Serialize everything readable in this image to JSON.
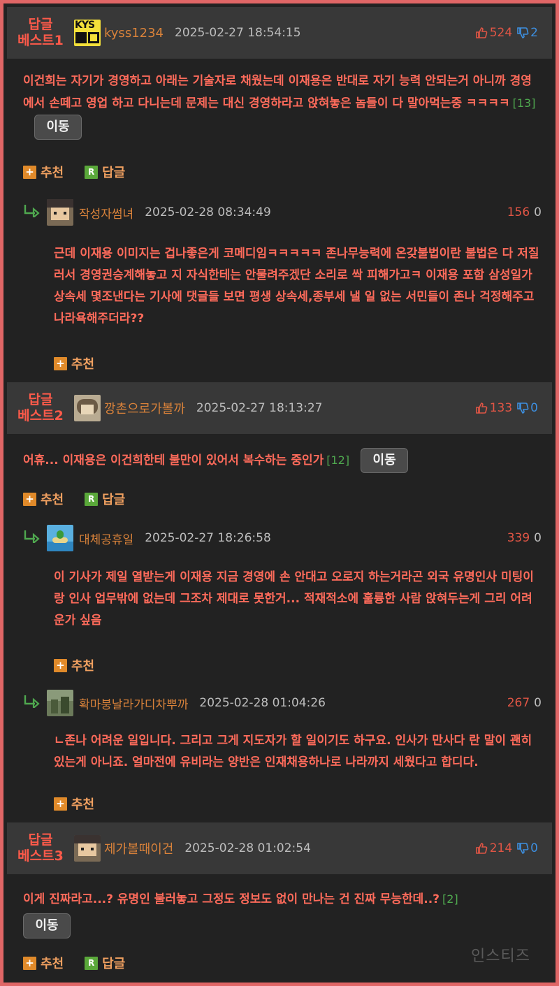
{
  "icons": {
    "thumb_up": "thumb-up-icon",
    "thumb_down": "thumb-down-icon",
    "reply_arrow": "reply-arrow-icon",
    "plus": "plus-icon",
    "reply_r": "reply-r-icon"
  },
  "colors": {
    "accent_red": "#ff6b5b",
    "username": "#d9823a",
    "count_green": "#4fa84f",
    "down_blue": "#3d8fe0"
  },
  "labels": {
    "recommend": "추천",
    "reply": "답글",
    "move": "이동",
    "arrow": "↳"
  },
  "best": [
    {
      "label_line1": "답글",
      "label_line2": "베스트1",
      "username": "kyss1234",
      "avatar_text": "KYS",
      "date": "2025-02-27 18:54:15",
      "up": "524",
      "down": "2",
      "text": "이건희는 자기가 경영하고 아래는 기술자로 채웠는데 이재용은 반대로 자기 능력 안되는거 아니까 경영에서 손떼고 영업 하고 다니는데 문제는 대신 경영하라고 앉혀놓은 놈들이 다 말아먹는중 ㅋㅋㅋㅋ",
      "count": "[13]",
      "replies": [
        {
          "username": "작성자썸녀",
          "date": "2025-02-28 08:34:49",
          "up": "156",
          "down": "0",
          "text": "근데 이재용 이미지는 겁나좋은게 코메디임ㅋㅋㅋㅋㅋ 존나무능력에 온갖불법이란 불법은 다 저질러서 경영권승계해놓고 지 자식한테는 안물려주겠단 소리로 싹 피해가고ㅋ 이재용 포함 삼성일가 상속세 몇조낸다는 기사에 댓글들 보면 평생 상속세,종부세 낼 일 없는 서민들이 존나 걱정해주고 나라욕해주더라??"
        }
      ]
    },
    {
      "label_line1": "답글",
      "label_line2": "베스트2",
      "username": "깡촌으로가볼까",
      "date": "2025-02-27 18:13:27",
      "up": "133",
      "down": "0",
      "text": "어휴... 이재용은 이건희한테 불만이 있어서 복수하는 중인가",
      "count": "[12]",
      "replies": [
        {
          "username": "대체공휴일",
          "date": "2025-02-27 18:26:58",
          "up": "339",
          "down": "0",
          "text": "이 기사가 제일 열받는게 이재용 지금 경영에 손 안대고 오로지 하는거라곤 외국 유명인사 미팅이랑 인사 업무밖에 없는데 그조차 제대로 못한거... 적재적소에 훌륭한 사람 앉혀두는게 그리 어려운가 싶음"
        },
        {
          "username": "확마붕날라가디차뿌까",
          "date": "2025-02-28 01:04:26",
          "up": "267",
          "down": "0",
          "text": "ㄴ존나 어려운 일입니다. 그리고 그게 지도자가 할 일이기도 하구요. 인사가 만사다 란 말이 괜히 있는게 아니죠. 얼마전에 유비라는 양반은 인재채용하나로 나라까지 세웠다고 합디다."
        }
      ]
    },
    {
      "label_line1": "답글",
      "label_line2": "베스트3",
      "username": "제가볼때이건",
      "date": "2025-02-28 01:02:54",
      "up": "214",
      "down": "0",
      "text": "이게 진짜라고...? 유명인 불러놓고 그정도 정보도 없이 만나는 건 진짜 무능한데..?",
      "count": "[2]",
      "replies": []
    }
  ],
  "watermark": "인스티즈"
}
